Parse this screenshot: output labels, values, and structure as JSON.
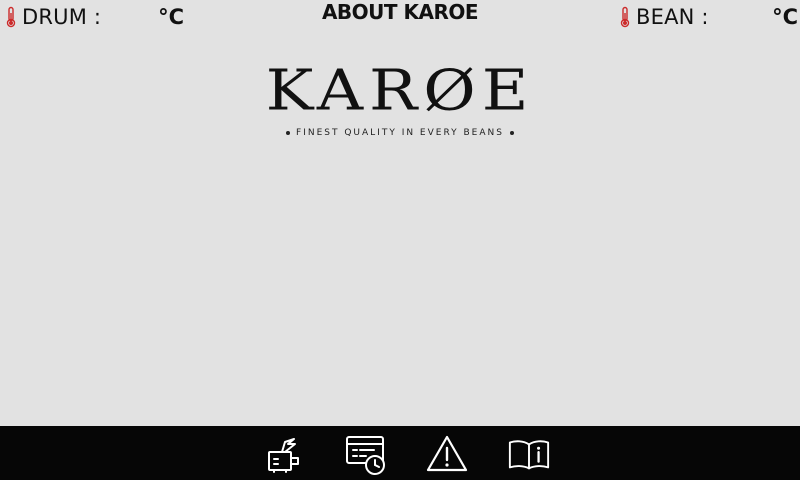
{
  "page": {
    "title": "ABOUT KAROE"
  },
  "status": {
    "drum": {
      "label": "DRUM :",
      "value": "",
      "unit": "°C"
    },
    "bean": {
      "label": "BEAN :",
      "value": "",
      "unit": "°C"
    }
  },
  "logo": {
    "wordmark": "KARØE",
    "tagline": "FINEST QUALITY IN EVERY BEANS"
  },
  "colors": {
    "background": "#e2e2e2",
    "bottom_bar": "#060606",
    "thermometer": "#cc2a2a",
    "text": "#111111",
    "icon": "#ffffff"
  },
  "nav": {
    "items": [
      {
        "icon": "roaster-icon"
      },
      {
        "icon": "recipe-history-icon"
      },
      {
        "icon": "warning-icon"
      },
      {
        "icon": "manual-info-icon"
      }
    ]
  }
}
